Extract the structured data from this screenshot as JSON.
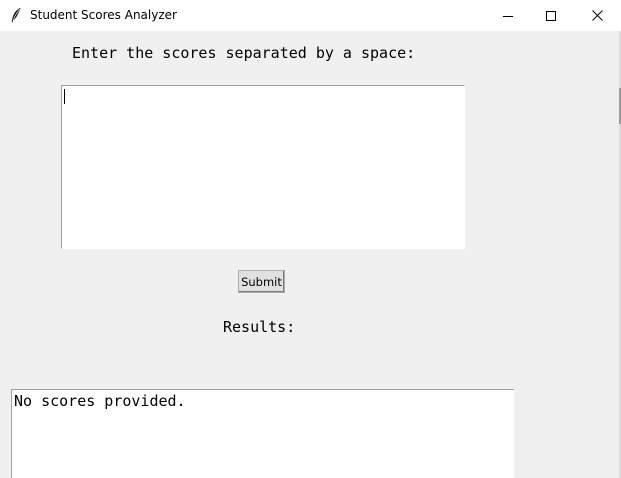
{
  "window": {
    "title": "Student Scores Analyzer",
    "app_icon": "feather-icon",
    "controls": {
      "minimize_icon": "minimize-icon",
      "maximize_icon": "maximize-icon",
      "close_icon": "close-icon"
    }
  },
  "form": {
    "prompt_label": "Enter the scores separated by a space:",
    "scores_value": "",
    "submit_label": "Submit"
  },
  "results": {
    "label": "Results:",
    "output_text": "No scores provided."
  }
}
